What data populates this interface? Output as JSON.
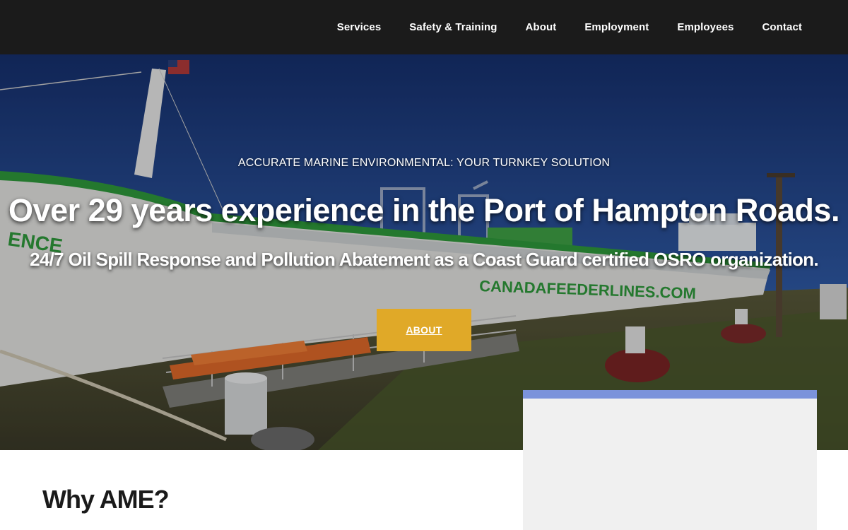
{
  "nav": {
    "items": [
      {
        "label": "Services",
        "name": "nav-services"
      },
      {
        "label": "Safety & Training",
        "name": "nav-safety-training"
      },
      {
        "label": "About",
        "name": "nav-about"
      },
      {
        "label": "Employment",
        "name": "nav-employment"
      },
      {
        "label": "Employees",
        "name": "nav-employees"
      },
      {
        "label": "Contact",
        "name": "nav-contact"
      }
    ]
  },
  "hero": {
    "kicker": "ACCURATE MARINE ENVIRONMENTAL: YOUR TURNKEY SOLUTION",
    "headline": "Over 29 years experience in the Port of Hampton Roads.",
    "subhead": "24/7 Oil Spill Response and Pollution Abatement as a Coast Guard certified OSRO organization.",
    "button_label": "ABOUT",
    "ship_hull_text": "CANADAFEEDERLINES.COM",
    "ship_bow_text": "ENCE"
  },
  "section": {
    "title": "Why AME?"
  },
  "colors": {
    "topbar": "#1b1b1b",
    "accent_button": "#e0a928",
    "card_border": "#7b93db",
    "card_bg": "#f0f0f0"
  }
}
